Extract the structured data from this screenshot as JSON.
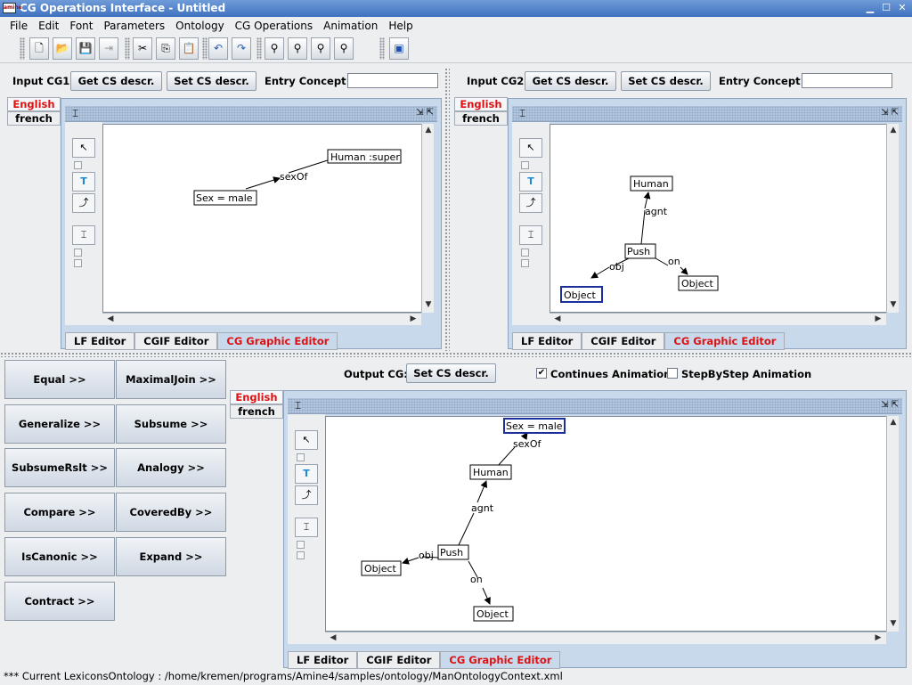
{
  "window": {
    "title": "CG Operations Interface - Untitled",
    "icon_text": "amine"
  },
  "menu": [
    "File",
    "Edit",
    "Font",
    "Parameters",
    "Ontology",
    "CG Operations",
    "Animation",
    "Help"
  ],
  "toolbar": {
    "icons": [
      "new-file-icon",
      "open-folder-icon",
      "save-icon",
      "export-icon",
      "cut-icon",
      "copy-icon",
      "paste-icon",
      "undo-icon",
      "redo-icon",
      "find-icon",
      "find-next-icon",
      "find-replace-icon",
      "find-all-icon",
      "help-book-icon"
    ]
  },
  "input1": {
    "label": "Input CG1",
    "get_btn": "Get CS descr.",
    "set_btn": "Set CS descr.",
    "entry_label": "Entry Concept :",
    "entry_value": "",
    "lang_tabs": [
      "English",
      "french"
    ],
    "editor_tabs": [
      "LF Editor",
      "CGIF Editor",
      "CG Graphic Editor"
    ],
    "graph": {
      "concepts": [
        "Human :super",
        "Sex = male"
      ],
      "relations": [
        "sexOf"
      ]
    }
  },
  "input2": {
    "label": "Input CG2",
    "get_btn": "Get CS descr.",
    "set_btn": "Set CS descr.",
    "entry_label": "Entry Concept :",
    "entry_value": "",
    "lang_tabs": [
      "English",
      "french"
    ],
    "editor_tabs": [
      "LF Editor",
      "CGIF Editor",
      "CG Graphic Editor"
    ],
    "graph": {
      "concepts": [
        "Human",
        "Push",
        "Object",
        "Object"
      ],
      "relations": [
        "agnt",
        "obj",
        "on"
      ]
    }
  },
  "operations": [
    "Equal  >>",
    "MaximalJoin >>",
    "Generalize  >>",
    "Subsume      >>",
    "SubsumeRslt >>",
    "Analogy      >>",
    "Compare     >>",
    "CoveredBy   >>",
    "IsCanonic    >>",
    "Expand       >>",
    "Contract    >>"
  ],
  "output": {
    "label": "Output CG:",
    "set_btn": "Set CS descr.",
    "continues_label": "Continues Animation",
    "continues_checked": true,
    "stepbystep_label": "StepByStep Animation",
    "stepbystep_checked": false,
    "lang_tabs": [
      "English",
      "french"
    ],
    "editor_tabs": [
      "LF Editor",
      "CGIF Editor",
      "CG Graphic Editor"
    ],
    "graph": {
      "concepts": [
        "Sex = male",
        "Human",
        "Push",
        "Object",
        "Object"
      ],
      "relations": [
        "sexOf",
        "agnt",
        "obj",
        "on"
      ]
    }
  },
  "status": "*** Current LexiconsOntology : /home/kremen/programs/Amine4/samples/ontology/ManOntologyContext.xml"
}
